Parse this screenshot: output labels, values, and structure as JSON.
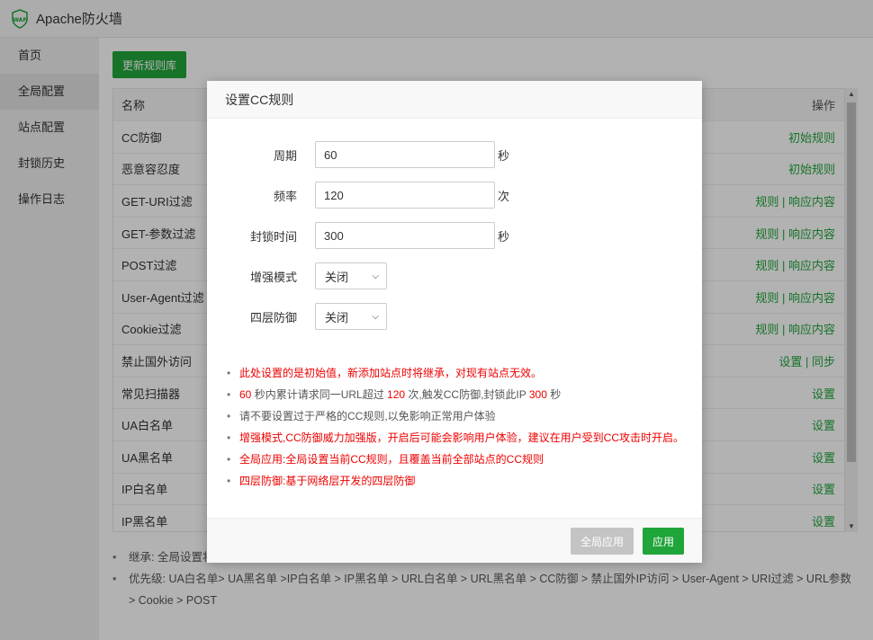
{
  "app": {
    "title": "Apache防火墙",
    "icon": "waf-shield-icon"
  },
  "sidebar": {
    "items": [
      {
        "label": "首页",
        "active": false
      },
      {
        "label": "全局配置",
        "active": true
      },
      {
        "label": "站点配置",
        "active": false
      },
      {
        "label": "封锁历史",
        "active": false
      },
      {
        "label": "操作日志",
        "active": false
      }
    ]
  },
  "main": {
    "update_button": "更新规则库",
    "table": {
      "headers": {
        "name": "名称",
        "op": "操作"
      },
      "rows": [
        {
          "name": "CC防御",
          "op": "初始规则"
        },
        {
          "name": "恶意容忍度",
          "op": "初始规则"
        },
        {
          "name": "GET-URI过滤",
          "op": "规则 | 响应内容"
        },
        {
          "name": "GET-参数过滤",
          "op": "规则 | 响应内容"
        },
        {
          "name": "POST过滤",
          "op": "规则 | 响应内容"
        },
        {
          "name": "User-Agent过滤",
          "op": "规则 | 响应内容"
        },
        {
          "name": "Cookie过滤",
          "op": "规则 | 响应内容"
        },
        {
          "name": "禁止国外访问",
          "op": "设置 | 同步"
        },
        {
          "name": "常见扫描器",
          "op": "设置"
        },
        {
          "name": "UA白名单",
          "op": "设置"
        },
        {
          "name": "UA黑名单",
          "op": "设置"
        },
        {
          "name": "IP白名单",
          "op": "设置"
        },
        {
          "name": "IP黑名单",
          "op": "设置"
        }
      ]
    },
    "notes": [
      "继承: 全局设置将",
      "优先级: UA白名单> UA黑名单 >IP白名单 > IP黑名单 > URL白名单 > URL黑名单 > CC防御 > 禁止国外IP访问 > User-Agent > URI过滤 > URL参数 > Cookie > POST"
    ]
  },
  "modal": {
    "title": "设置CC规则",
    "fields": {
      "period": {
        "label": "周期",
        "value": "60",
        "unit": "秒"
      },
      "frequency": {
        "label": "频率",
        "value": "120",
        "unit": "次"
      },
      "block_time": {
        "label": "封锁时间",
        "value": "300",
        "unit": "秒"
      },
      "enhanced_mode": {
        "label": "增强模式",
        "value": "关闭"
      },
      "layer4": {
        "label": "四层防御",
        "value": "关闭"
      }
    },
    "tips": {
      "t1": "此处设置的是初始值，新添加站点时将继承，对现有站点无效。",
      "t2_num1": "60",
      "t2_part1": " 秒内累计请求同一URL超过 ",
      "t2_num2": "120",
      "t2_part2": " 次,触发CC防御,封锁此IP ",
      "t2_num3": "300",
      "t2_part3": " 秒",
      "t3": "请不要设置过于严格的CC规则,以免影响正常用户体验",
      "t4": "增强模式,CC防御威力加强版，开启后可能会影响用户体验，建议在用户受到CC攻击时开启。",
      "t5": "全局应用:全局设置当前CC规则，且覆盖当前全部站点的CC规则",
      "t6": "四层防御:基于网络层开发的四层防御"
    },
    "buttons": {
      "global_apply": "全局应用",
      "apply": "应用"
    }
  }
}
